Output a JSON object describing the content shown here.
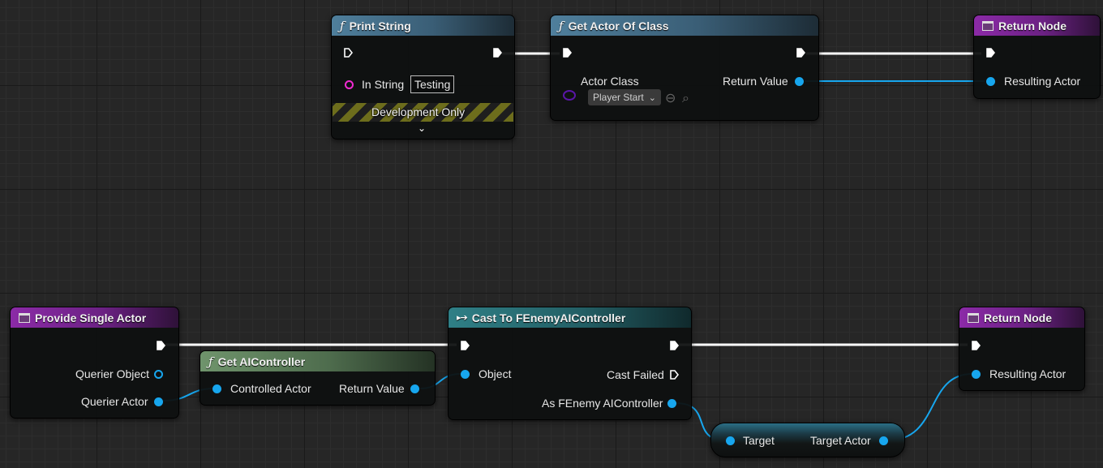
{
  "nodes": {
    "print_string": {
      "title": "Print String",
      "in_string_label": "In String",
      "in_string_value": "Testing",
      "development_only": "Development Only"
    },
    "get_actor_of_class": {
      "title": "Get Actor Of Class",
      "actor_class_label": "Actor Class",
      "actor_class_value": "Player Start",
      "return_value_label": "Return Value"
    },
    "return_node_top": {
      "title": "Return Node",
      "resulting_actor_label": "Resulting Actor"
    },
    "provide_single_actor": {
      "title": "Provide Single Actor",
      "querier_object_label": "Querier Object",
      "querier_actor_label": "Querier Actor"
    },
    "get_aicontroller": {
      "title": "Get AIController",
      "controlled_actor_label": "Controlled Actor",
      "return_value_label": "Return Value"
    },
    "cast_to_fenemy": {
      "title": "Cast To FEnemyAIController",
      "object_label": "Object",
      "cast_failed_label": "Cast Failed",
      "as_fenemy_label": "As FEnemy AIController"
    },
    "return_node_bottom": {
      "title": "Return Node",
      "resulting_actor_label": "Resulting Actor"
    },
    "target_actor_node": {
      "target_label": "Target",
      "target_actor_label": "Target Actor"
    }
  },
  "colors": {
    "exec_wire": "#ffffff",
    "object_wire": "#17a6ee",
    "string_pin": "#f22ad2",
    "class_pin": "#5a16a8"
  },
  "icons": {
    "function": "function-icon",
    "event": "event-box-icon",
    "cast": "cast-arrow-icon"
  }
}
